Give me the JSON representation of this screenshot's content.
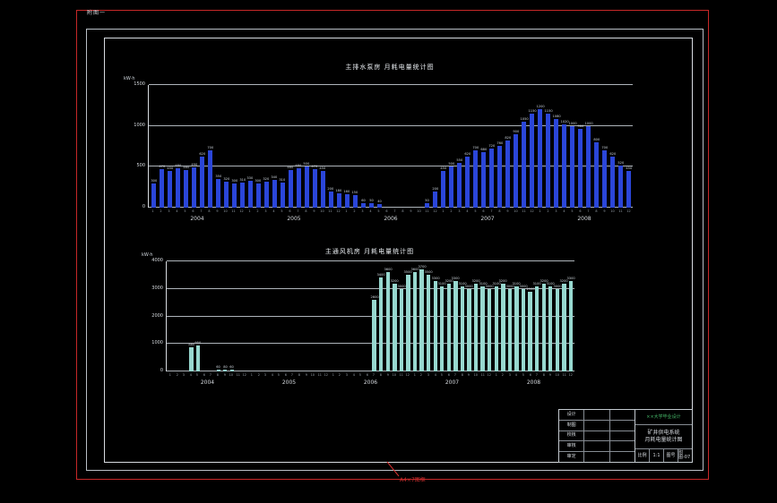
{
  "page": {
    "corner_note": "附图一",
    "frame_note": "A4×7图框"
  },
  "chart_data": [
    {
      "type": "bar",
      "title": "主排水泵房 月耗电量统计图",
      "unit": "kW·h",
      "color": "#2b46d9",
      "ylim": [
        0,
        1500
      ],
      "yticks": [
        0,
        500,
        1000,
        1500
      ],
      "years": [
        "2004",
        "2005",
        "2006",
        "2007",
        "2008"
      ],
      "values": [
        300,
        470,
        450,
        480,
        460,
        490,
        620,
        700,
        350,
        320,
        300,
        310,
        330,
        300,
        320,
        340,
        310,
        460,
        480,
        500,
        470,
        450,
        200,
        180,
        160,
        150,
        60,
        50,
        40,
        0,
        0,
        0,
        0,
        0,
        50,
        200,
        450,
        500,
        550,
        620,
        700,
        680,
        720,
        760,
        820,
        900,
        1050,
        1150,
        1200,
        1150,
        1080,
        1020,
        1000,
        960,
        1000,
        800,
        700,
        620,
        520,
        450
      ]
    },
    {
      "type": "bar",
      "title": "主通风机房 月耗电量统计图",
      "unit": "kW·h",
      "color": "#97d8cf",
      "ylim": [
        0,
        4000
      ],
      "yticks": [
        0,
        1000,
        2000,
        3000,
        4000
      ],
      "years": [
        "2004",
        "2005",
        "2006",
        "2007",
        "2008"
      ],
      "values": [
        0,
        0,
        0,
        880,
        950,
        0,
        0,
        60,
        80,
        60,
        0,
        0,
        0,
        0,
        0,
        0,
        0,
        0,
        0,
        0,
        0,
        0,
        0,
        0,
        0,
        0,
        0,
        0,
        0,
        0,
        2600,
        3400,
        3600,
        3200,
        3000,
        3500,
        3600,
        3700,
        3500,
        3300,
        3100,
        3200,
        3300,
        3100,
        3000,
        3200,
        3100,
        3000,
        3100,
        3200,
        3000,
        3100,
        3000,
        2900,
        3100,
        3200,
        3100,
        3000,
        3200,
        3300
      ]
    }
  ],
  "titleblock": {
    "rows": [
      {
        "label": "设计"
      },
      {
        "label": "制图"
      },
      {
        "label": "校核"
      },
      {
        "label": "审核"
      },
      {
        "label": "审定"
      }
    ],
    "project": "××大学毕业设计",
    "title_line1": "矿井供电系统",
    "title_line2": "月耗电量统计图",
    "scale_label": "比例",
    "scale": "1:1",
    "sheet_label": "图号",
    "sheet": "附图-07"
  }
}
